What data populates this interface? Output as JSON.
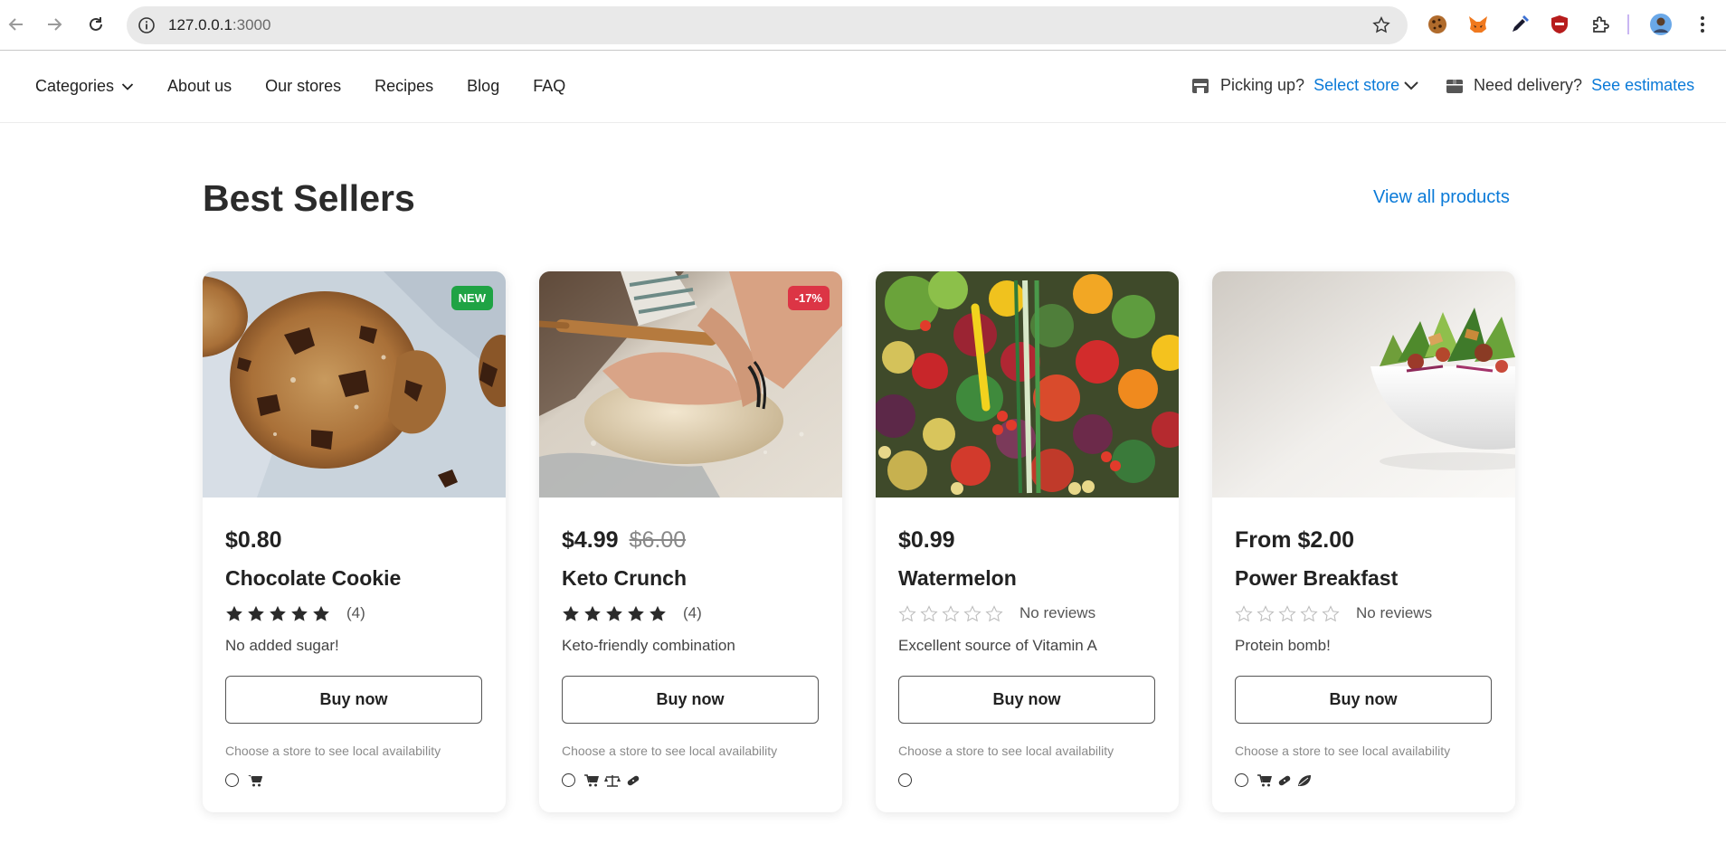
{
  "browser": {
    "url_host": "127.0.0.1",
    "url_port": ":3000",
    "icons": [
      "back-arrow-icon",
      "forward-arrow-icon",
      "reload-icon",
      "site-info-icon",
      "bookmark-star-icon",
      "cookie-extension-icon",
      "fox-extension-icon",
      "eyedropper-extension-icon",
      "shield-extension-icon",
      "puzzle-extensions-icon",
      "profile-avatar-icon",
      "kebab-menu-icon"
    ]
  },
  "header": {
    "menu": [
      "Categories",
      "About us",
      "Our stores",
      "Recipes",
      "Blog",
      "FAQ"
    ],
    "pickup_label": "Picking up?",
    "pickup_link": "Select store",
    "delivery_label": "Need delivery?",
    "delivery_link": "See estimates"
  },
  "section": {
    "title": "Best Sellers",
    "view_all": "View all products"
  },
  "colors": {
    "link": "#0a7ad8",
    "badge_new": "#1fa344",
    "badge_sale": "#dc3545"
  },
  "products": [
    {
      "badge": "NEW",
      "price": "$0.80",
      "old_price": "",
      "name": "Chocolate Cookie",
      "rating": 5,
      "reviews": "(4)",
      "description": "No added sugar!",
      "buy": "Buy now",
      "availability": "Choose a store to see local availability",
      "tag_icons": [
        "cart-icon"
      ]
    },
    {
      "badge": "-17%",
      "price": "$4.99",
      "old_price": "$6.00",
      "name": "Keto Crunch",
      "rating": 5,
      "reviews": "(4)",
      "description": "Keto-friendly combination",
      "buy": "Buy now",
      "availability": "Choose a store to see local availability",
      "tag_icons": [
        "cart-icon",
        "scale-icon",
        "bandage-icon"
      ]
    },
    {
      "badge": "",
      "price": "$0.99",
      "old_price": "",
      "name": "Watermelon",
      "rating": 0,
      "reviews": "No reviews",
      "description": "Excellent source of Vitamin A",
      "buy": "Buy now",
      "availability": "Choose a store to see local availability",
      "tag_icons": []
    },
    {
      "badge": "",
      "price": "From $2.00",
      "old_price": "",
      "name": "Power Breakfast",
      "rating": 0,
      "reviews": "No reviews",
      "description": "Protein bomb!",
      "buy": "Buy now",
      "availability": "Choose a store to see local availability",
      "tag_icons": [
        "cart-icon",
        "bandage-icon",
        "leaf-icon"
      ]
    }
  ]
}
